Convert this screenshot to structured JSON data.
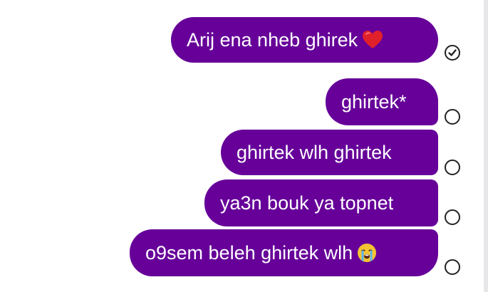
{
  "messages": [
    {
      "text": "Arij ena nheb ghirek",
      "emoji": "red-heart-icon",
      "status": "seen"
    },
    {
      "text": "ghirtek*",
      "emoji": null,
      "status": "sent"
    },
    {
      "text": "ghirtek wlh ghirtek",
      "emoji": null,
      "status": "sent"
    },
    {
      "text": "ya3n bouk ya topnet",
      "emoji": null,
      "status": "sent"
    },
    {
      "text": "o9sem beleh ghirtek wlh",
      "emoji": "crying-face-icon",
      "status": "sent"
    }
  ],
  "colors": {
    "bubble": "#660099",
    "bubble_text": "#ffffff",
    "status_ring": "#222222",
    "heart": "#e0202b",
    "emoji_face": "#f5c433"
  }
}
